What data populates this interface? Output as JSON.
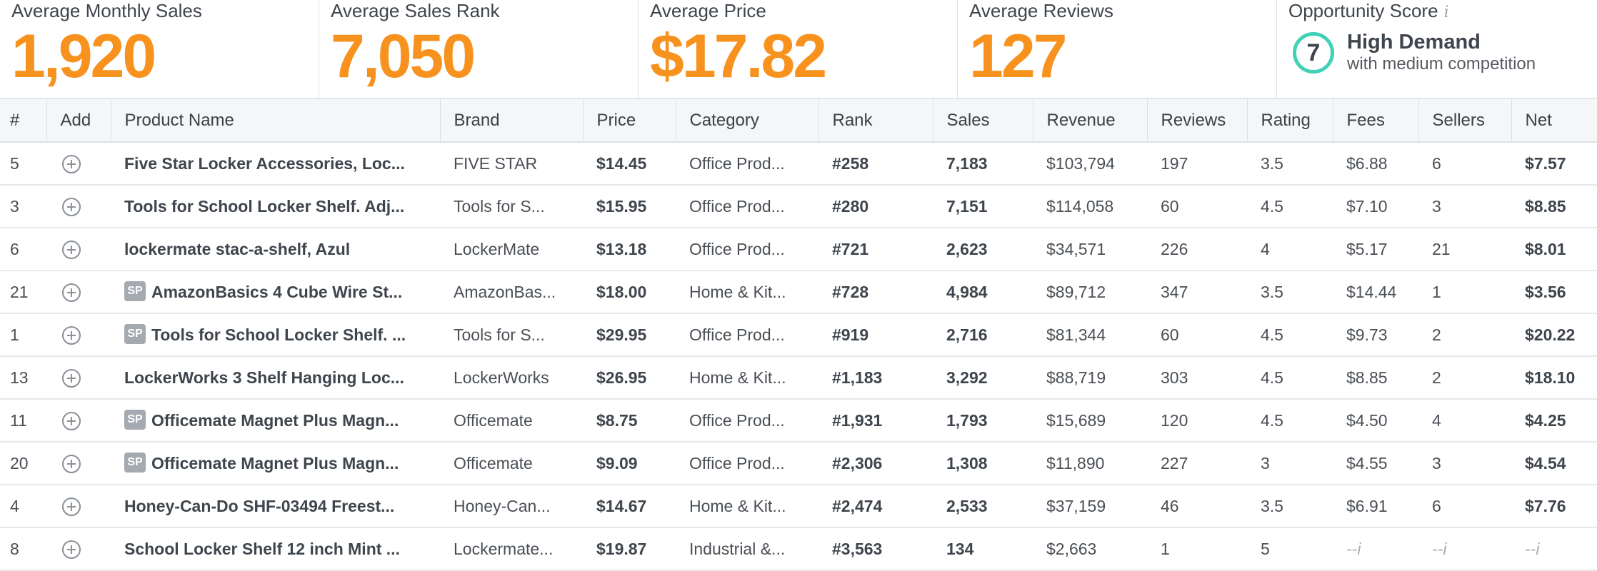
{
  "stats": {
    "monthly_sales": {
      "label": "Average Monthly Sales",
      "value": "1,920"
    },
    "sales_rank": {
      "label": "Average Sales Rank",
      "value": "7,050"
    },
    "price": {
      "label": "Average Price",
      "value": "$17.82"
    },
    "reviews": {
      "label": "Average Reviews",
      "value": "127"
    },
    "opportunity": {
      "label": "Opportunity Score",
      "info": "i",
      "score": "7",
      "title": "High Demand",
      "subtitle": "with medium competition"
    }
  },
  "colors": {
    "accent": "#f7921e",
    "score_ring": "#3fd2b6"
  },
  "table": {
    "headers": [
      "#",
      "Add",
      "Product Name",
      "Brand",
      "Price",
      "Category",
      "Rank",
      "Sales",
      "Revenue",
      "Reviews",
      "Rating",
      "Fees",
      "Sellers",
      "Net"
    ],
    "rows": [
      {
        "num": "5",
        "sp": false,
        "name": "Five Star Locker Accessories, Loc...",
        "brand": "FIVE STAR",
        "price": "$14.45",
        "category": "Office Prod...",
        "rank": "#258",
        "sales": "7,183",
        "revenue": "$103,794",
        "reviews": "197",
        "rating": "3.5",
        "fees": "$6.88",
        "sellers": "6",
        "net": "$7.57"
      },
      {
        "num": "3",
        "sp": false,
        "name": "Tools for School Locker Shelf. Adj...",
        "brand": "Tools for S...",
        "price": "$15.95",
        "category": "Office Prod...",
        "rank": "#280",
        "sales": "7,151",
        "revenue": "$114,058",
        "reviews": "60",
        "rating": "4.5",
        "fees": "$7.10",
        "sellers": "3",
        "net": "$8.85"
      },
      {
        "num": "6",
        "sp": false,
        "name": "lockermate stac-a-shelf, Azul",
        "brand": "LockerMate",
        "price": "$13.18",
        "category": "Office Prod...",
        "rank": "#721",
        "sales": "2,623",
        "revenue": "$34,571",
        "reviews": "226",
        "rating": "4",
        "fees": "$5.17",
        "sellers": "21",
        "net": "$8.01"
      },
      {
        "num": "21",
        "sp": true,
        "sp_label": "SP",
        "name": "AmazonBasics 4 Cube Wire St...",
        "brand": "AmazonBas...",
        "price": "$18.00",
        "category": "Home & Kit...",
        "rank": "#728",
        "sales": "4,984",
        "revenue": "$89,712",
        "reviews": "347",
        "rating": "3.5",
        "fees": "$14.44",
        "sellers": "1",
        "net": "$3.56"
      },
      {
        "num": "1",
        "sp": true,
        "sp_label": "SP",
        "name": "Tools for School Locker Shelf. ...",
        "brand": "Tools for S...",
        "price": "$29.95",
        "category": "Office Prod...",
        "rank": "#919",
        "sales": "2,716",
        "revenue": "$81,344",
        "reviews": "60",
        "rating": "4.5",
        "fees": "$9.73",
        "sellers": "2",
        "net": "$20.22"
      },
      {
        "num": "13",
        "sp": false,
        "name": "LockerWorks 3 Shelf Hanging Loc...",
        "brand": "LockerWorks",
        "price": "$26.95",
        "category": "Home & Kit...",
        "rank": "#1,183",
        "sales": "3,292",
        "revenue": "$88,719",
        "reviews": "303",
        "rating": "4.5",
        "fees": "$8.85",
        "sellers": "2",
        "net": "$18.10"
      },
      {
        "num": "11",
        "sp": true,
        "sp_label": "SP",
        "name": "Officemate Magnet Plus Magn...",
        "brand": "Officemate",
        "price": "$8.75",
        "category": "Office Prod...",
        "rank": "#1,931",
        "sales": "1,793",
        "revenue": "$15,689",
        "reviews": "120",
        "rating": "4.5",
        "fees": "$4.50",
        "sellers": "4",
        "net": "$4.25"
      },
      {
        "num": "20",
        "sp": true,
        "sp_label": "SP",
        "name": "Officemate Magnet Plus Magn...",
        "brand": "Officemate",
        "price": "$9.09",
        "category": "Office Prod...",
        "rank": "#2,306",
        "sales": "1,308",
        "revenue": "$11,890",
        "reviews": "227",
        "rating": "3",
        "fees": "$4.55",
        "sellers": "3",
        "net": "$4.54"
      },
      {
        "num": "4",
        "sp": false,
        "name": "Honey-Can-Do SHF-03494 Freest...",
        "brand": "Honey-Can...",
        "price": "$14.67",
        "category": "Home & Kit...",
        "rank": "#2,474",
        "sales": "2,533",
        "revenue": "$37,159",
        "reviews": "46",
        "rating": "3.5",
        "fees": "$6.91",
        "sellers": "6",
        "net": "$7.76"
      },
      {
        "num": "8",
        "sp": false,
        "name": "School Locker Shelf 12 inch Mint ...",
        "brand": "Lockermate...",
        "price": "$19.87",
        "category": "Industrial &...",
        "rank": "#3,563",
        "sales": "134",
        "revenue": "$2,663",
        "reviews": "1",
        "rating": "5",
        "fees": "--i",
        "sellers": "--i",
        "net": "--i"
      }
    ]
  }
}
